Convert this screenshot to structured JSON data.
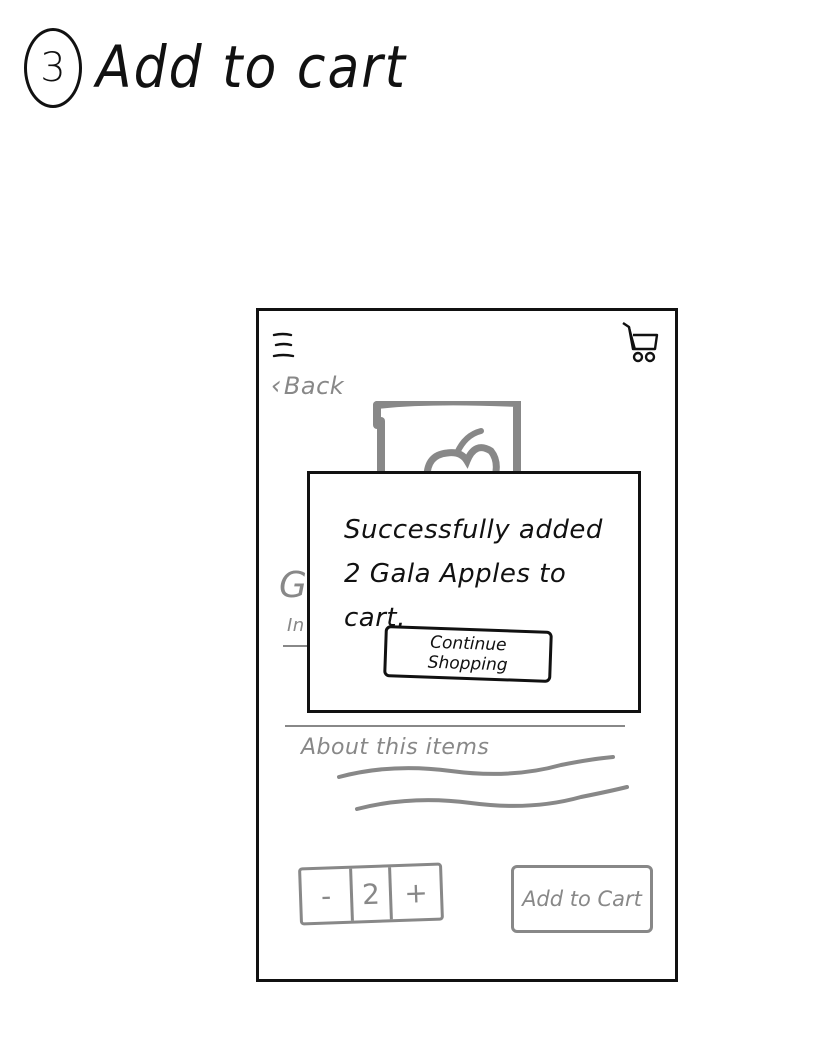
{
  "step": {
    "number": "3",
    "title": "Add to cart"
  },
  "header": {
    "menu_icon": "hamburger-menu-icon",
    "cart_icon": "shopping-cart-icon"
  },
  "nav": {
    "back_label": "Back"
  },
  "product": {
    "name_partial": "G",
    "subtitle_partial": "In"
  },
  "about": {
    "title": "About this items"
  },
  "quantity": {
    "decrement_label": "-",
    "value": "2",
    "increment_label": "+"
  },
  "actions": {
    "add_to_cart_label": "Add to Cart"
  },
  "dialog": {
    "message": "Successfully added 2 Gala Apples to cart.",
    "continue_label": "Continue Shopping"
  },
  "colors": {
    "ink": "#111111",
    "muted_ink": "#888888",
    "background": "#ffffff"
  }
}
